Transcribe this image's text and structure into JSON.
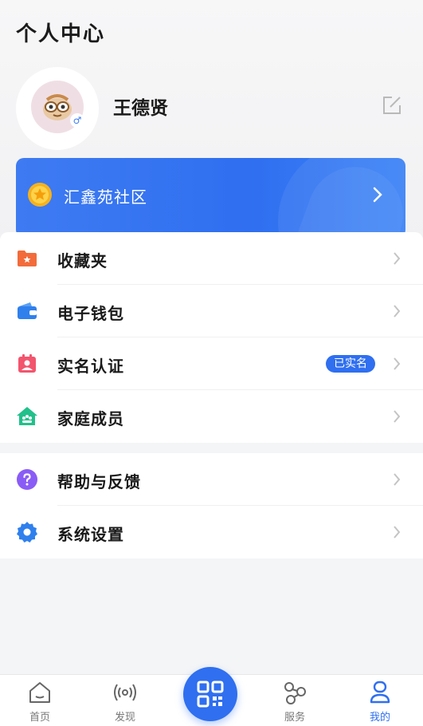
{
  "header": {
    "title": "个人中心"
  },
  "profile": {
    "name": "王德贤",
    "gender_icon": "male-icon"
  },
  "community": {
    "name": "汇鑫苑社区"
  },
  "menu_group1": [
    {
      "label": "收藏夹",
      "icon": "folder-star-icon",
      "color": "#f26b3a"
    },
    {
      "label": "电子钱包",
      "icon": "wallet-icon",
      "color": "#2f80ed"
    },
    {
      "label": "实名认证",
      "icon": "id-card-icon",
      "color": "#f2556d",
      "badge": "已实名"
    },
    {
      "label": "家庭成员",
      "icon": "family-home-icon",
      "color": "#22c08a"
    }
  ],
  "menu_group2": [
    {
      "label": "帮助与反馈",
      "icon": "help-icon",
      "color": "#8a5cf6"
    },
    {
      "label": "系统设置",
      "icon": "settings-icon",
      "color": "#2f80ed"
    }
  ],
  "tabbar": {
    "home": "首页",
    "discover": "发现",
    "services": "服务",
    "mine": "我的",
    "active": "mine"
  },
  "colors": {
    "accent": "#2f6ff0"
  }
}
